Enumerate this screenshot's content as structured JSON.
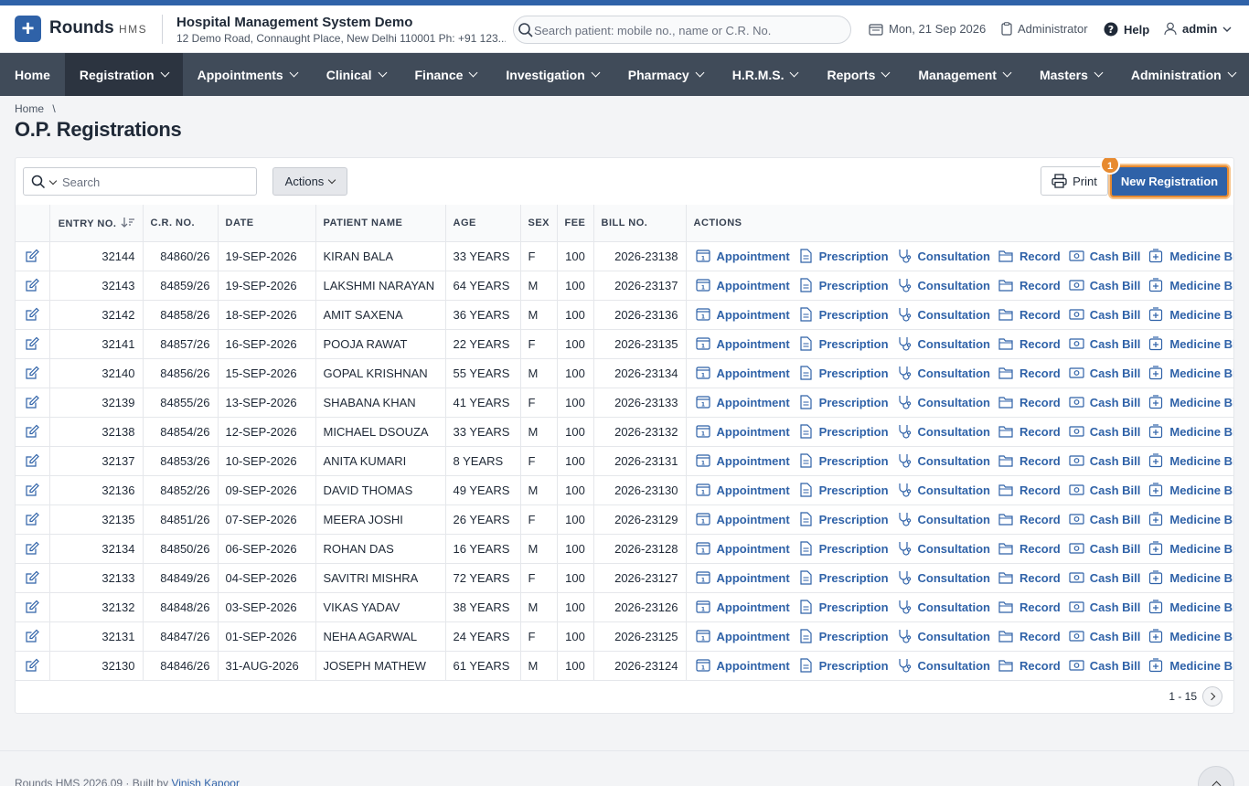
{
  "header": {
    "brand": "Rounds",
    "brand_sub": "HMS",
    "org_name": "Hospital Management System Demo",
    "org_address": "12 Demo Road, Connaught Place, New Delhi 110001 Ph: +91 123...",
    "search_placeholder": "Search patient: mobile no., name or C.R. No.",
    "date": "Mon, 21 Sep 2026",
    "role": "Administrator",
    "help": "Help",
    "user": "admin"
  },
  "nav": [
    {
      "label": "Home",
      "dropdown": false
    },
    {
      "label": "Registration",
      "dropdown": true,
      "active": true
    },
    {
      "label": "Appointments",
      "dropdown": true
    },
    {
      "label": "Clinical",
      "dropdown": true
    },
    {
      "label": "Finance",
      "dropdown": true
    },
    {
      "label": "Investigation",
      "dropdown": true
    },
    {
      "label": "Pharmacy",
      "dropdown": true
    },
    {
      "label": "H.R.M.S.",
      "dropdown": true
    },
    {
      "label": "Reports",
      "dropdown": true
    },
    {
      "label": "Management",
      "dropdown": true
    },
    {
      "label": "Masters",
      "dropdown": true
    },
    {
      "label": "Administration",
      "dropdown": true
    }
  ],
  "breadcrumb": {
    "home": "Home",
    "sep": "\\"
  },
  "page_title": "O.P. Registrations",
  "toolbar": {
    "search_placeholder": "Search",
    "actions_label": "Actions",
    "print_label": "Print",
    "new_registration_label": "New Registration",
    "badge": "1"
  },
  "table": {
    "columns": [
      "",
      "ENTRY NO.",
      "C.R. NO.",
      "DATE",
      "PATIENT NAME",
      "AGE",
      "SEX",
      "FEE",
      "BILL NO.",
      "ACTIONS"
    ],
    "action_labels": [
      "Appointment",
      "Prescription",
      "Consultation",
      "Record",
      "Cash Bill",
      "Medicine Bill"
    ],
    "rows": [
      {
        "entry": "32144",
        "cr": "84860/26",
        "date": "19-SEP-2026",
        "name": "KIRAN BALA",
        "age": "33 YEARS",
        "sex": "F",
        "fee": "100",
        "bill": "2026-23138"
      },
      {
        "entry": "32143",
        "cr": "84859/26",
        "date": "19-SEP-2026",
        "name": "LAKSHMI NARAYAN",
        "age": "64 YEARS",
        "sex": "M",
        "fee": "100",
        "bill": "2026-23137"
      },
      {
        "entry": "32142",
        "cr": "84858/26",
        "date": "18-SEP-2026",
        "name": "AMIT SAXENA",
        "age": "36 YEARS",
        "sex": "M",
        "fee": "100",
        "bill": "2026-23136"
      },
      {
        "entry": "32141",
        "cr": "84857/26",
        "date": "16-SEP-2026",
        "name": "POOJA RAWAT",
        "age": "22 YEARS",
        "sex": "F",
        "fee": "100",
        "bill": "2026-23135"
      },
      {
        "entry": "32140",
        "cr": "84856/26",
        "date": "15-SEP-2026",
        "name": "GOPAL KRISHNAN",
        "age": "55 YEARS",
        "sex": "M",
        "fee": "100",
        "bill": "2026-23134"
      },
      {
        "entry": "32139",
        "cr": "84855/26",
        "date": "13-SEP-2026",
        "name": "SHABANA KHAN",
        "age": "41 YEARS",
        "sex": "F",
        "fee": "100",
        "bill": "2026-23133"
      },
      {
        "entry": "32138",
        "cr": "84854/26",
        "date": "12-SEP-2026",
        "name": "MICHAEL DSOUZA",
        "age": "33 YEARS",
        "sex": "M",
        "fee": "100",
        "bill": "2026-23132"
      },
      {
        "entry": "32137",
        "cr": "84853/26",
        "date": "10-SEP-2026",
        "name": "ANITA KUMARI",
        "age": "8 YEARS",
        "sex": "F",
        "fee": "100",
        "bill": "2026-23131"
      },
      {
        "entry": "32136",
        "cr": "84852/26",
        "date": "09-SEP-2026",
        "name": "DAVID THOMAS",
        "age": "49 YEARS",
        "sex": "M",
        "fee": "100",
        "bill": "2026-23130"
      },
      {
        "entry": "32135",
        "cr": "84851/26",
        "date": "07-SEP-2026",
        "name": "MEERA JOSHI",
        "age": "26 YEARS",
        "sex": "F",
        "fee": "100",
        "bill": "2026-23129"
      },
      {
        "entry": "32134",
        "cr": "84850/26",
        "date": "06-SEP-2026",
        "name": "ROHAN DAS",
        "age": "16 YEARS",
        "sex": "M",
        "fee": "100",
        "bill": "2026-23128"
      },
      {
        "entry": "32133",
        "cr": "84849/26",
        "date": "04-SEP-2026",
        "name": "SAVITRI MISHRA",
        "age": "72 YEARS",
        "sex": "F",
        "fee": "100",
        "bill": "2026-23127"
      },
      {
        "entry": "32132",
        "cr": "84848/26",
        "date": "03-SEP-2026",
        "name": "VIKAS YADAV",
        "age": "38 YEARS",
        "sex": "M",
        "fee": "100",
        "bill": "2026-23126"
      },
      {
        "entry": "32131",
        "cr": "84847/26",
        "date": "01-SEP-2026",
        "name": "NEHA AGARWAL",
        "age": "24 YEARS",
        "sex": "F",
        "fee": "100",
        "bill": "2026-23125"
      },
      {
        "entry": "32130",
        "cr": "84846/26",
        "date": "31-AUG-2026",
        "name": "JOSEPH MATHEW",
        "age": "61 YEARS",
        "sex": "M",
        "fee": "100",
        "bill": "2026-23124"
      }
    ]
  },
  "pager": {
    "range": "1 - 15"
  },
  "footer": {
    "text": "Rounds HMS 2026.09 · Built by",
    "author": "Vinish Kapoor"
  },
  "colors": {
    "brand": "#2f62a8",
    "nav": "#404b59",
    "nav_active": "#2c3440",
    "highlight": "#e78a2f"
  }
}
